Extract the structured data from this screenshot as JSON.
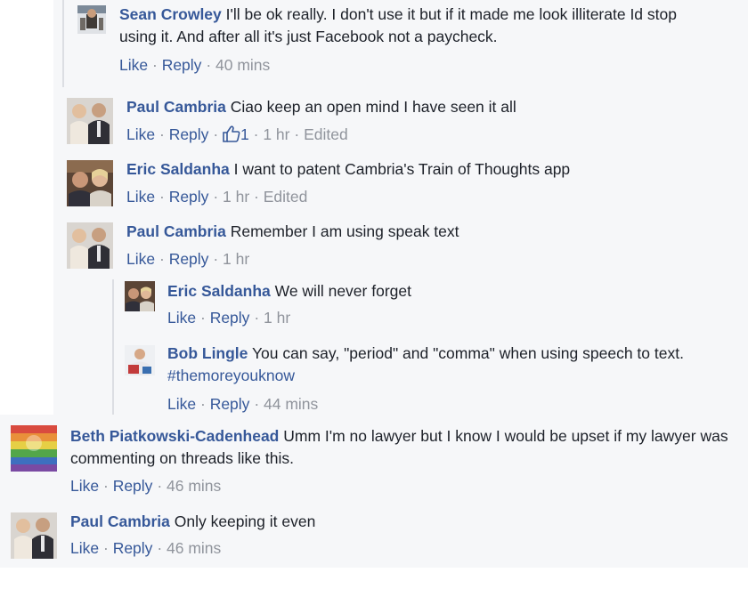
{
  "comments": [
    {
      "author": "Sean Crowley",
      "text": "I'll be ok really. I don't use it but if it made me look illiterate Id stop using it. And after all it's just Facebook not a paycheck.",
      "like": "Like",
      "reply": "Reply",
      "time": "40 mins"
    },
    {
      "author": "Paul Cambria",
      "text": "Ciao keep an open mind I have seen it all",
      "like": "Like",
      "reply": "Reply",
      "reactions": "1",
      "time": "1 hr",
      "edited": "Edited"
    },
    {
      "author": "Eric Saldanha",
      "text": "I want to patent Cambria's Train of Thoughts app",
      "like": "Like",
      "reply": "Reply",
      "time": "1 hr",
      "edited": "Edited"
    },
    {
      "author": "Paul Cambria",
      "text": "Remember I am using speak text",
      "like": "Like",
      "reply": "Reply",
      "time": "1 hr"
    },
    {
      "author": "Eric Saldanha",
      "text": "We will never forget",
      "like": "Like",
      "reply": "Reply",
      "time": "1 hr"
    },
    {
      "author": "Bob Lingle",
      "text": "You can say, \"period\" and \"comma\" when using speech to text.",
      "hashtag": "#themoreyouknow",
      "like": "Like",
      "reply": "Reply",
      "time": "44 mins"
    },
    {
      "author": "Beth Piatkowski-Cadenhead",
      "text": "Umm I'm no lawyer but I know I would be upset if my lawyer was commenting on threads like this.",
      "like": "Like",
      "reply": "Reply",
      "time": "46 mins"
    },
    {
      "author": "Paul Cambria",
      "text": "Only keeping it even",
      "like": "Like",
      "reply": "Reply",
      "time": "46 mins"
    }
  ],
  "separator": "·",
  "colors": {
    "link": "#365899",
    "meta": "#90949c",
    "panel": "#f6f7f9"
  }
}
